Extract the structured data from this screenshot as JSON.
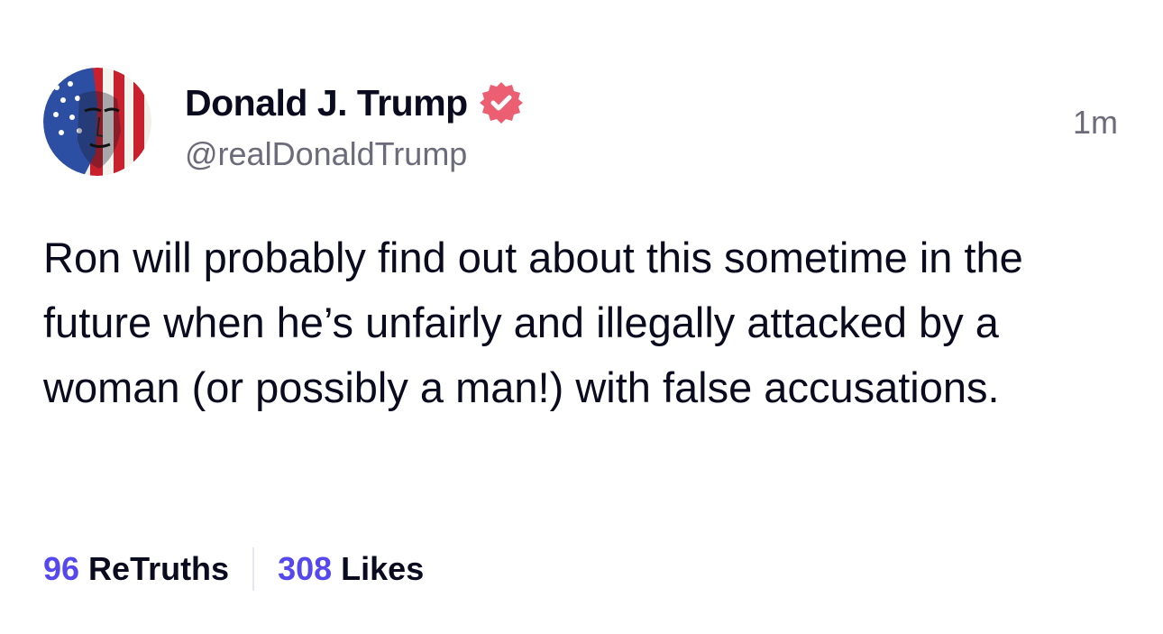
{
  "post": {
    "author": {
      "display_name": "Donald J. Trump",
      "handle": "@realDonaldTrump",
      "verified": true,
      "verified_color": "#ec5f73",
      "avatar_icon": "flag-portrait-avatar"
    },
    "timestamp": "1m",
    "text": "Ron will probably find out about this sometime in the future when he’s unfairly and illegally attacked by a woman (or possibly a man!) with false accusations.",
    "stats": {
      "retruths_count": "96",
      "retruths_label": "ReTruths",
      "likes_count": "308",
      "likes_label": "Likes"
    },
    "colors": {
      "accent": "#5448ee",
      "text": "#0b0b1f",
      "muted": "#6b6b7a"
    }
  }
}
